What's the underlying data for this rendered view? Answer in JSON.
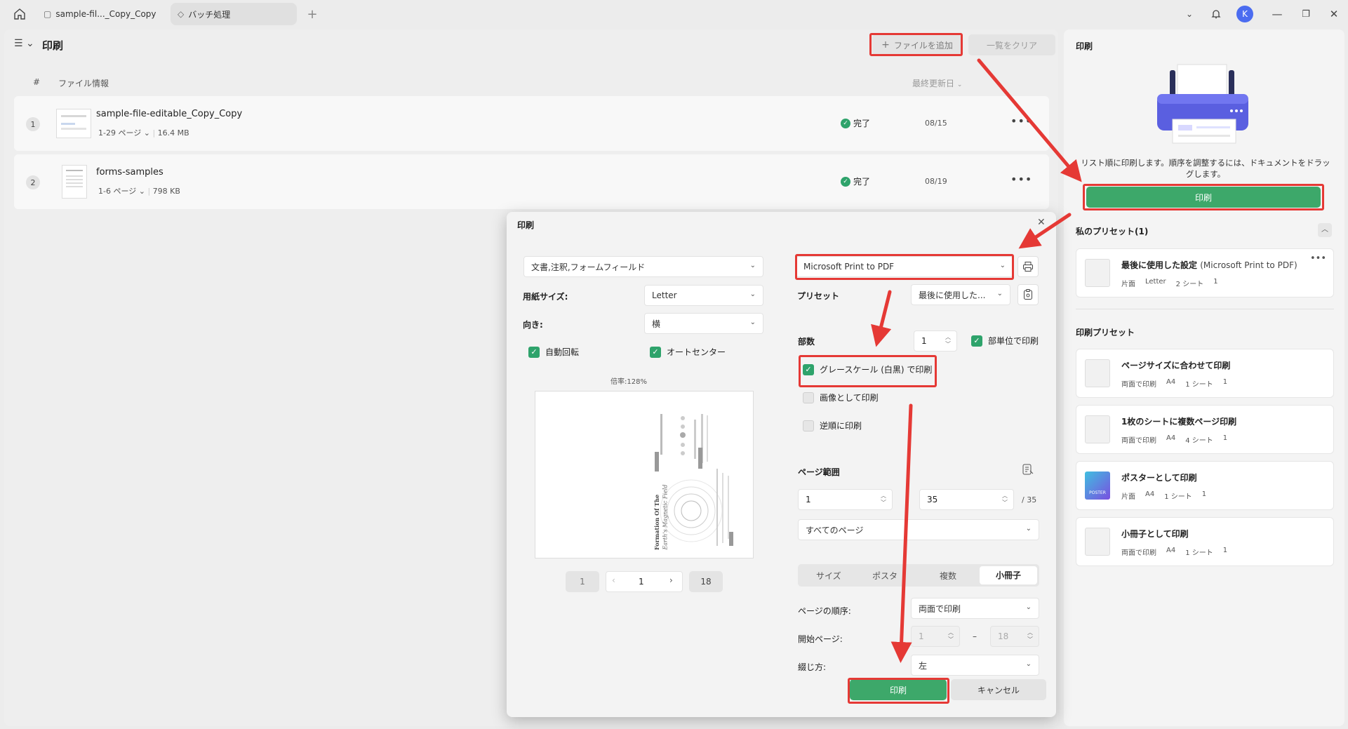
{
  "titlebar": {
    "tabs": [
      {
        "label": "sample-fil..._Copy_Copy",
        "icon": "chat-bubble-icon"
      },
      {
        "label": "バッチ処理",
        "icon": "tag-icon"
      }
    ],
    "add_tab": "+",
    "avatar_letter": "K"
  },
  "main": {
    "title": "印刷",
    "add_files": "ファイルを追加",
    "clear_list": "一覧をクリア",
    "columns": {
      "num": "#",
      "info": "ファイル情報",
      "modified": "最終更新日"
    },
    "files": [
      {
        "num": "1",
        "name": "sample-file-editable_Copy_Copy",
        "pages": "1-29 ページ",
        "size": "16.4 MB",
        "status": "完了",
        "date": "08/15"
      },
      {
        "num": "2",
        "name": "forms-samples",
        "pages": "1-6 ページ",
        "size": "798 KB",
        "status": "完了",
        "date": "08/19"
      }
    ]
  },
  "right_panel": {
    "title": "印刷",
    "description": "リスト順に印刷します。順序を調整するには、ドキュメントをドラッグします。",
    "print_button": "印刷",
    "my_presets_label": "私のプリセット(1)",
    "my_presets": [
      {
        "title": "最後に使用した設定",
        "subtitle": "(Microsoft Print to PDF)",
        "sides": "片面",
        "paper": "Letter",
        "sheets": "2 シート",
        "copies": "1"
      }
    ],
    "print_presets_label": "印刷プリセット",
    "print_presets": [
      {
        "title": "ページサイズに合わせて印刷",
        "sides": "両面で印刷",
        "paper": "A4",
        "sheets": "1 シート",
        "copies": "1"
      },
      {
        "title": "1枚のシートに複数ページ印刷",
        "sides": "両面で印刷",
        "paper": "A4",
        "sheets": "4 シート",
        "copies": "1"
      },
      {
        "title": "ポスターとして印刷",
        "sides": "片面",
        "paper": "A4",
        "sheets": "1 シート",
        "copies": "1",
        "icon_text": "POSTER"
      },
      {
        "title": "小冊子として印刷",
        "sides": "両面で印刷",
        "paper": "A4",
        "sheets": "1 シート",
        "copies": "1"
      }
    ]
  },
  "dialog": {
    "title": "印刷",
    "content_select": "文書,注釈,フォームフィールド",
    "paper_size_label": "用紙サイズ:",
    "paper_size": "Letter",
    "orientation_label": "向き:",
    "orientation": "横",
    "auto_rotate": "自動回転",
    "auto_center": "オートセンター",
    "scale": "倍率:128%",
    "preview_text": {
      "title": "Formation Of The",
      "subtitle": "Earth's Magnetic Field"
    },
    "pager": {
      "first": "1",
      "current": "1",
      "last": "18"
    },
    "printer": "Microsoft Print to PDF",
    "preset_label": "プリセット",
    "preset_value": "最後に使用した...",
    "copies_label": "部数",
    "copies": "1",
    "collate": "部単位で印刷",
    "grayscale": "グレースケール (白黒) で印刷",
    "as_image": "画像として印刷",
    "reverse": "逆順に印刷",
    "page_range_label": "ページ範囲",
    "range_from": "1",
    "range_to": "35",
    "range_total": "/ 35",
    "range_mode": "すべてのページ",
    "mode_tabs": [
      "サイズ",
      "ポスター",
      "複数",
      "小冊子"
    ],
    "page_order_label": "ページの順序:",
    "page_order": "両面で印刷",
    "start_page_label": "開始ページ:",
    "start_from": "1",
    "start_dash": "–",
    "start_to": "18",
    "binding_label": "綴じ方:",
    "binding": "左",
    "print_button": "印刷",
    "cancel_button": "キャンセル"
  },
  "colors": {
    "accent_green": "#3da86a",
    "annotation_red": "#e53935"
  }
}
